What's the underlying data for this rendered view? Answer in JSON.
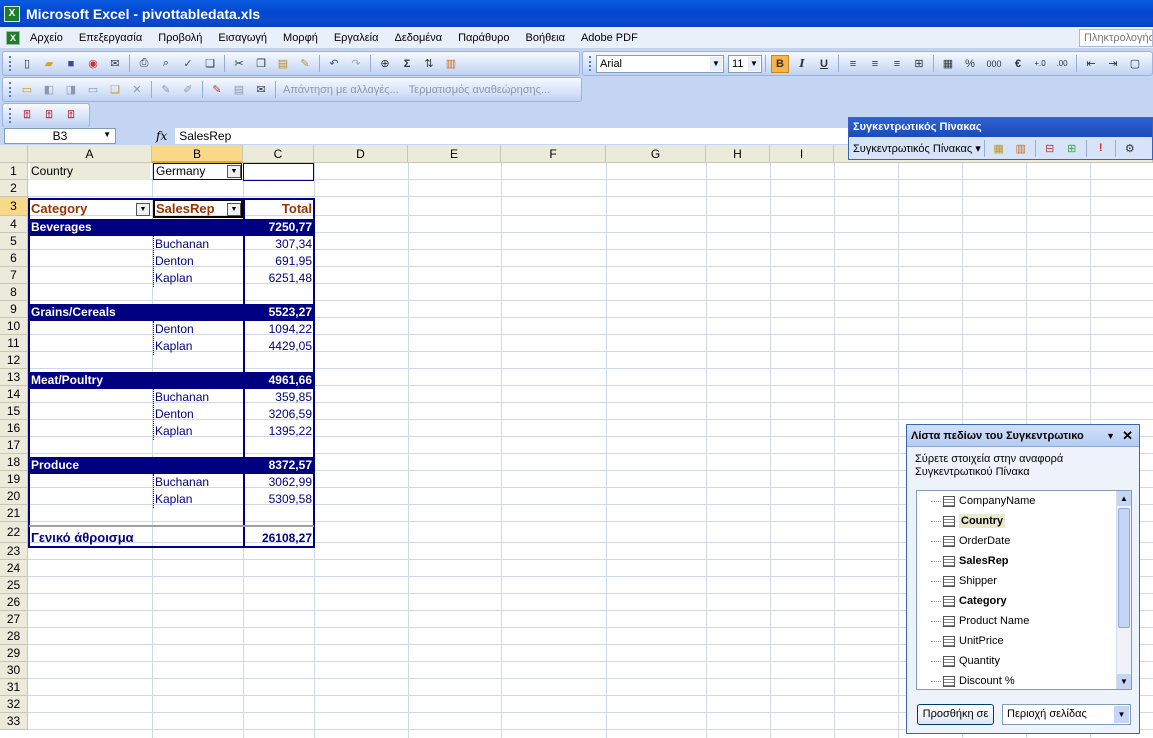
{
  "window": {
    "title": "Microsoft Excel - pivottabledata.xls",
    "app_icon": "excel-icon"
  },
  "menu": {
    "items": [
      "Αρχείο",
      "Επεξεργασία",
      "Προβολή",
      "Εισαγωγή",
      "Μορφή",
      "Εργαλεία",
      "Δεδομένα",
      "Παράθυρο",
      "Βοήθεια",
      "Adobe PDF"
    ],
    "help_placeholder": "Πληκτρολογήσ"
  },
  "formatting": {
    "font_name": "Arial",
    "font_size": "11",
    "bold": "B",
    "italic": "I",
    "underline": "U",
    "percent": "%",
    "thousands": "000",
    "euro": "€"
  },
  "toolbar2": {
    "reply_changes": "Απάντηση με αλλαγές...",
    "end_review": "Τερματισμός αναθεώρησης..."
  },
  "formula_bar": {
    "name_box": "B3",
    "fx": "fx",
    "content": "SalesRep"
  },
  "columns": [
    "A",
    "B",
    "C",
    "D",
    "E",
    "F",
    "G",
    "H",
    "I"
  ],
  "selected_column": "B",
  "rows": [
    "1",
    "2",
    "3",
    "4",
    "5",
    "6",
    "7",
    "8",
    "9",
    "10",
    "11",
    "12",
    "13",
    "14",
    "15",
    "16",
    "17",
    "18",
    "19",
    "20",
    "21",
    "22",
    "23",
    "24",
    "25",
    "26",
    "27",
    "28",
    "29",
    "30",
    "31",
    "32",
    "33"
  ],
  "selected_row": "3",
  "pivot": {
    "page_field_label": "Country",
    "page_field_value": "Germany",
    "header_category": "Category",
    "header_salesrep": "SalesRep",
    "header_total": "Total",
    "cells": {
      "r4a": "Beverages",
      "r4c": "7250,77",
      "r5b": "Buchanan",
      "r5c": "307,34",
      "r6b": "Denton",
      "r6c": "691,95",
      "r7b": "Kaplan",
      "r7c": "6251,48",
      "r9a": "Grains/Cereals",
      "r9c": "5523,27",
      "r10b": "Denton",
      "r10c": "1094,22",
      "r11b": "Kaplan",
      "r11c": "4429,05",
      "r13a": "Meat/Poultry",
      "r13c": "4961,66",
      "r14b": "Buchanan",
      "r14c": "359,85",
      "r15b": "Denton",
      "r15c": "3206,59",
      "r16b": "Kaplan",
      "r16c": "1395,22",
      "r18a": "Produce",
      "r18c": "8372,57",
      "r19b": "Buchanan",
      "r19c": "3062,99",
      "r20b": "Kaplan",
      "r20c": "5309,58",
      "r22a": "Γενικό άθροισμα",
      "r22c": "26108,27"
    }
  },
  "pivot_toolbar": {
    "title": "Συγκεντρωτικός Πίνακας",
    "menu_label": "Συγκεντρωτικός Πίνακας ▾"
  },
  "field_list": {
    "title": "Λίστα πεδίων του Συγκεντρωτικο",
    "description": "Σύρετε στοιχεία στην αναφορά Συγκεντρωτικού Πίνακα",
    "fields": [
      {
        "label": "CompanyName",
        "bold": false,
        "hilite": false
      },
      {
        "label": "Country",
        "bold": true,
        "hilite": true
      },
      {
        "label": "OrderDate",
        "bold": false,
        "hilite": false
      },
      {
        "label": "SalesRep",
        "bold": true,
        "hilite": false
      },
      {
        "label": "Shipper",
        "bold": false,
        "hilite": false
      },
      {
        "label": "Category",
        "bold": true,
        "hilite": false
      },
      {
        "label": "Product Name",
        "bold": false,
        "hilite": false
      },
      {
        "label": "UnitPrice",
        "bold": false,
        "hilite": false
      },
      {
        "label": "Quantity",
        "bold": false,
        "hilite": false
      },
      {
        "label": "Discount %",
        "bold": false,
        "hilite": false
      }
    ],
    "add_button": "Προσθήκη σε",
    "area_select": "Περιοχή σελίδας"
  }
}
